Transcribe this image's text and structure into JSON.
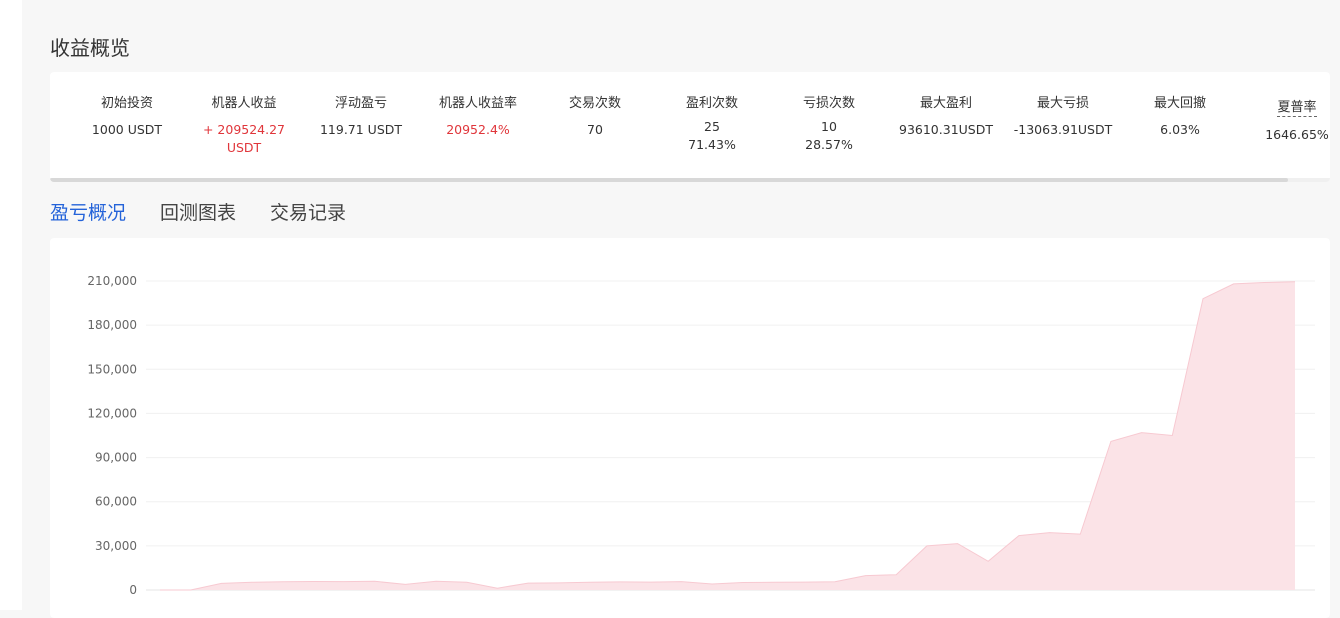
{
  "summary": {
    "title": "收益概览",
    "stats": [
      {
        "label": "初始投资",
        "value": "1000 USDT"
      },
      {
        "label": "机器人收益",
        "value": "+ 209524.27\nUSDT",
        "highlight": "red"
      },
      {
        "label": "浮动盈亏",
        "value": "119.71 USDT"
      },
      {
        "label": "机器人收益率",
        "value": "20952.4%",
        "highlight": "red"
      },
      {
        "label": "交易次数",
        "value": "70"
      },
      {
        "label": "盈利次数",
        "value": "25\n71.43%"
      },
      {
        "label": "亏损次数",
        "value": "10\n28.57%"
      },
      {
        "label": "最大盈利",
        "value": "93610.31USDT"
      },
      {
        "label": "最大亏损",
        "value": "-13063.91USDT"
      },
      {
        "label": "最大回撤",
        "value": "6.03%"
      },
      {
        "label": "夏普率",
        "value": "1646.65%",
        "underline": true
      }
    ]
  },
  "tabs": [
    {
      "label": "盈亏概况",
      "active": true
    },
    {
      "label": "回测图表",
      "active": false
    },
    {
      "label": "交易记录",
      "active": false
    }
  ],
  "colors": {
    "accent": "#2463d9",
    "profit_red": "#e0363b",
    "area_fill": "#fbe3e7",
    "area_line": "#f7c9d1"
  },
  "chart_data": {
    "type": "area",
    "title": "",
    "xlabel": "",
    "ylabel": "",
    "ylim": [
      0,
      210000
    ],
    "yticks": [
      "0",
      "30,000",
      "60,000",
      "90,000",
      "120,000",
      "150,000",
      "180,000",
      "210,000"
    ],
    "grid": true,
    "series": [
      {
        "values": [
          0,
          0,
          4500,
          5200,
          5600,
          5800,
          5700,
          5900,
          3800,
          6000,
          5200,
          1200,
          4700,
          4800,
          5300,
          5500,
          5400,
          5700,
          4100,
          5100,
          5200,
          5400,
          5600,
          9800,
          10400,
          30000,
          31500,
          19500,
          37000,
          39000,
          38000,
          101000,
          107000,
          105000,
          198000,
          208000,
          209000,
          209500
        ]
      }
    ]
  }
}
